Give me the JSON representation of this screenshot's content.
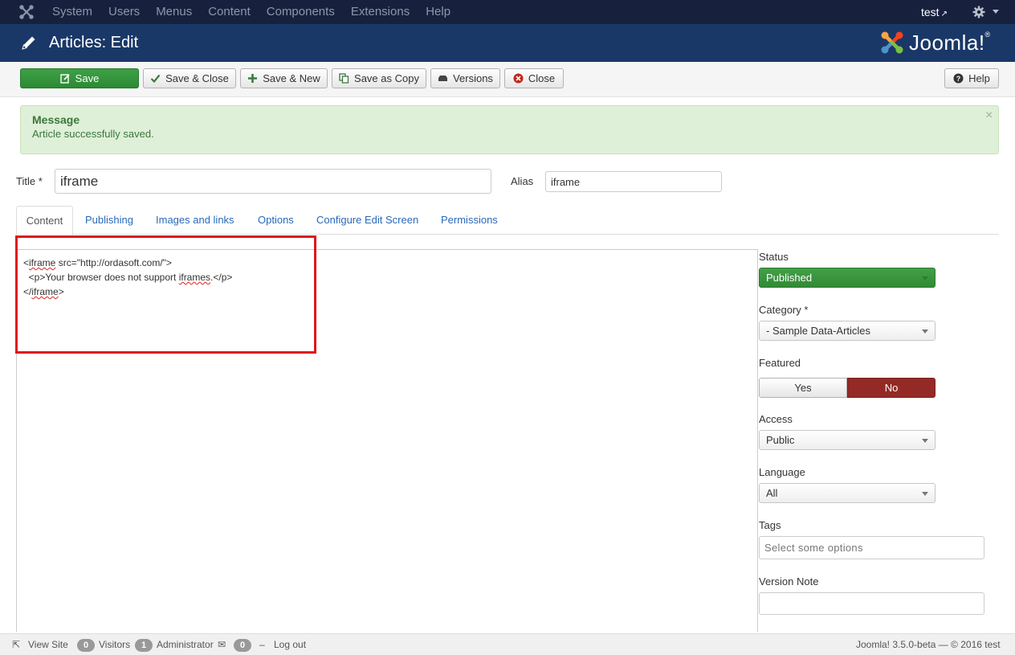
{
  "topnav": {
    "menu": [
      "System",
      "Users",
      "Menus",
      "Content",
      "Components",
      "Extensions",
      "Help"
    ],
    "user": "test"
  },
  "header": {
    "title": "Articles: Edit",
    "brand": "Joomla!",
    "brand_mark": "®"
  },
  "toolbar": {
    "save": "Save",
    "save_close": "Save & Close",
    "save_new": "Save & New",
    "save_copy": "Save as Copy",
    "versions": "Versions",
    "close": "Close",
    "help": "Help"
  },
  "message": {
    "heading": "Message",
    "text": "Article successfully saved.",
    "close": "×"
  },
  "form": {
    "title_label": "Title *",
    "title_value": "iframe",
    "alias_label": "Alias",
    "alias_value": "iframe"
  },
  "tabs": [
    "Content",
    "Publishing",
    "Images and links",
    "Options",
    "Configure Edit Screen",
    "Permissions"
  ],
  "editor": {
    "line1_a": "<",
    "line1_tag": "iframe",
    "line1_b": " src=\"http://ordasoft.com/\">",
    "line2_a": "  <p>Your browser does not support ",
    "line2_word": "iframes",
    "line2_b": ".</p>",
    "line3_a": "</",
    "line3_tag": "iframe",
    "line3_b": ">"
  },
  "sidebar": {
    "status_label": "Status",
    "status_value": "Published",
    "category_label": "Category *",
    "category_value": "- Sample Data-Articles",
    "featured_label": "Featured",
    "featured_yes": "Yes",
    "featured_no": "No",
    "access_label": "Access",
    "access_value": "Public",
    "language_label": "Language",
    "language_value": "All",
    "tags_label": "Tags",
    "tags_placeholder": "Select some options",
    "version_label": "Version Note",
    "version_value": ""
  },
  "statusbar": {
    "view_site": "View Site",
    "visitors_count": "0",
    "visitors": "Visitors",
    "admins_count": "1",
    "admins": "Administrator",
    "messages_count": "0",
    "logout": "Log out",
    "version": "Joomla! 3.5.0-beta — © 2016 test"
  },
  "colors": {
    "nav": "#17213e",
    "header": "#1a3867",
    "save_green": "#2d8a34",
    "no_red": "#942a25",
    "highlight": "#e0141b"
  }
}
